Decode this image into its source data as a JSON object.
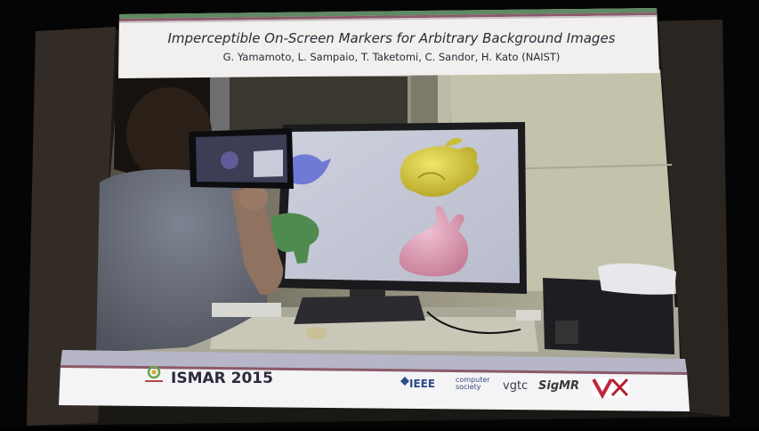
{
  "slide": {
    "title": "Imperceptible On-Screen Markers for Arbitrary Background Images",
    "authors": "G. Yamamoto, L. Sampaio, T. Taketomi, C. Sandor, H. Kato (NAIST)",
    "footer": {
      "conference": "ISMAR 2015",
      "sponsors": {
        "ieee": "IEEE",
        "computer_society": "computer society",
        "vgtc": "vgtc",
        "sigmr": "SigMR"
      }
    }
  },
  "colors": {
    "banner_top": "#5f8a64",
    "banner_stripe": "#8c5a6a",
    "footer_band": "#b6b6c8",
    "monitor_screen": "#c4c9da",
    "dragon": "#d8cf3e",
    "bunny": "#dea3b8",
    "teapot": "#6f79d6",
    "green_model": "#4f8a4f"
  },
  "icons": [
    "ismar-logo-icon",
    "ieee-logo-icon",
    "vrsj-logo-icon"
  ]
}
